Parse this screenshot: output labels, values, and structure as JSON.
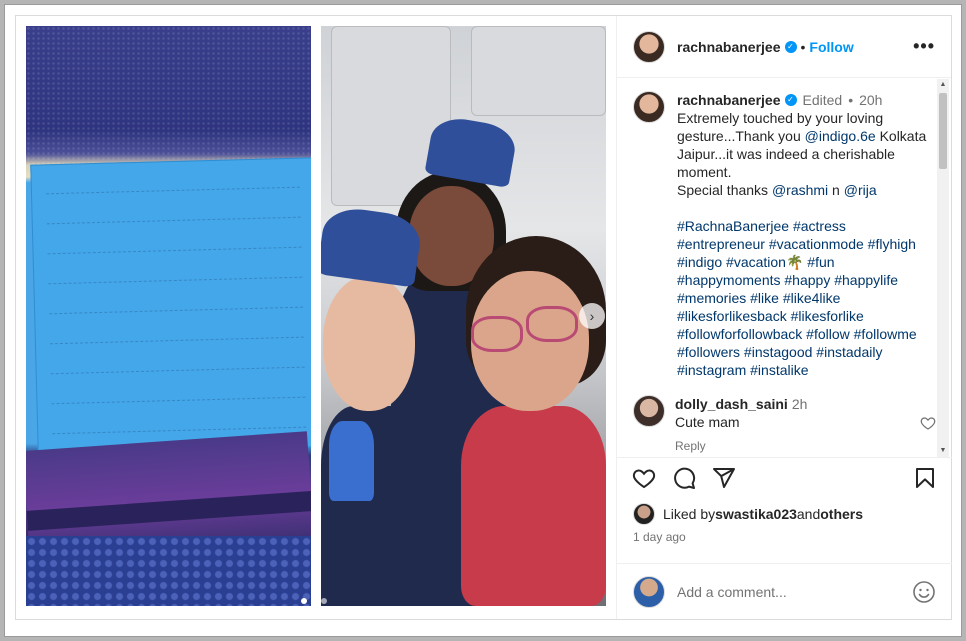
{
  "post": {
    "author": "rachnabanerjee",
    "header_separator": "•",
    "follow_label": "Follow",
    "more_label": "•••",
    "verified_mark": "✓"
  },
  "caption": {
    "username": "rachnabanerjee",
    "edited": "Edited",
    "dot": "•",
    "time": "20h",
    "text_1": "Extremely touched by your loving gesture...Thank you ",
    "mention_1": "@indigo.6e",
    "text_2": " Kolkata Jaipur...it was indeed a cherishable moment.",
    "text_3": "Special thanks ",
    "mention_2": "@rashmi",
    "text_4": " n ",
    "mention_3": "@rija",
    "hashtags": "#RachnaBanerjee #actress #entrepreneur #vacationmode #flyhigh #indigo #vacation🌴 #fun #happymoments #happy #happylife #memories #like #like4like #likesforlikesback #likesforlike #followforfollowback #follow #followme #followers #instagood #instadaily #instagram #instalike"
  },
  "comments": [
    {
      "username": "dolly_dash_saini",
      "time": "2h",
      "text": "Cute mam",
      "reply_label": "Reply"
    }
  ],
  "likes": {
    "prefix": "Liked by ",
    "user": "swastika023",
    "middle": " and ",
    "others": "others"
  },
  "timestamp": "1 day ago",
  "add_comment": {
    "placeholder": "Add a comment..."
  },
  "icons": {
    "like": "heart-icon",
    "comment": "comment-icon",
    "share": "share-icon",
    "save": "bookmark-icon",
    "emoji": "emoji-icon",
    "next": "chevron-right-icon"
  },
  "carousel": {
    "next_arrow": "›"
  },
  "colors": {
    "link": "#00376b",
    "accent": "#0095f6",
    "muted": "#737373"
  }
}
